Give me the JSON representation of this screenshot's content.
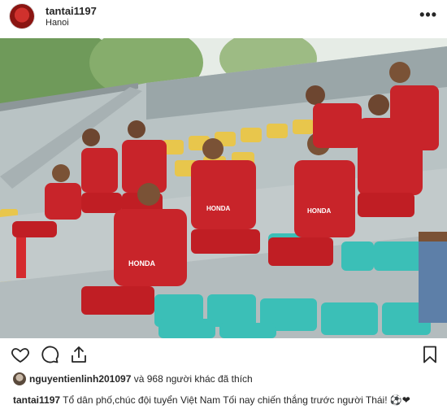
{
  "post": {
    "username": "tantai1197",
    "location": "Hanoi",
    "more_label": "•••",
    "likes": {
      "liker": "nguyentienlinh201097",
      "rest": " và 968 người khác đã thích"
    },
    "caption": {
      "username": "tantai1197",
      "text": "Tổ dân phố,chúc đội tuyển Việt Nam Tối nay chiến thắng trước người Thái! ⚽❤"
    },
    "jersey_text": "HONDA"
  },
  "icons": {
    "like": "heart-icon",
    "comment": "comment-icon",
    "share": "share-icon",
    "save": "bookmark-icon"
  },
  "colors": {
    "jersey": "#c8242a",
    "shorts": "#c01e24",
    "seat_teal": "#3bbfb7",
    "seat_yellow": "#e8c64c"
  }
}
